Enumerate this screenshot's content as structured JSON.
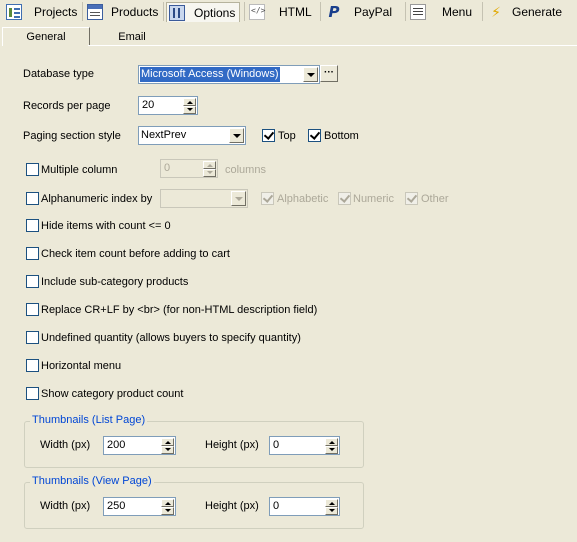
{
  "toolbar": {
    "items": [
      {
        "label": "Projects",
        "icon": "projects-icon"
      },
      {
        "label": "Products",
        "icon": "products-icon"
      },
      {
        "label": "Options",
        "icon": "options-icon",
        "active": true
      },
      {
        "label": "HTML",
        "icon": "html-icon"
      },
      {
        "label": "PayPal",
        "icon": "paypal-icon"
      },
      {
        "label": "Menu",
        "icon": "menu-icon"
      },
      {
        "label": "Generate",
        "icon": "generate-icon"
      }
    ]
  },
  "tabs": {
    "general": "General",
    "email": "Email"
  },
  "form": {
    "database_type": {
      "label": "Database type",
      "value": "Microsoft Access (Windows)",
      "dots": "···"
    },
    "records_per_page": {
      "label": "Records per page",
      "value": "20"
    },
    "paging_style": {
      "label": "Paging section style",
      "value": "NextPrev",
      "top_label": "Top",
      "top_checked": true,
      "bottom_label": "Bottom",
      "bottom_checked": true
    },
    "multiple_column": {
      "label": "Multiple column",
      "value": "0",
      "suffix": "columns",
      "checked": false
    },
    "alpha_index": {
      "label": "Alphanumeric index by",
      "value": "",
      "checked": false,
      "alphabetic": "Alphabetic",
      "numeric": "Numeric",
      "other": "Other"
    },
    "options": [
      {
        "label": "Hide items with count <= 0",
        "checked": false
      },
      {
        "label": "Check item count before adding to cart",
        "checked": false
      },
      {
        "label": "Include sub-category products",
        "checked": false
      },
      {
        "label": "Replace CR+LF by <br> (for non-HTML description field)",
        "checked": false
      },
      {
        "label": "Undefined quantity (allows buyers to specify quantity)",
        "checked": false
      },
      {
        "label": "Horizontal menu",
        "checked": false
      },
      {
        "label": "Show category product count",
        "checked": false
      }
    ],
    "thumb_list": {
      "title": "Thumbnails (List Page)",
      "width_label": "Width (px)",
      "width": "200",
      "height_label": "Height (px)",
      "height": "0"
    },
    "thumb_view": {
      "title": "Thumbnails (View Page)",
      "width_label": "Width (px)",
      "width": "250",
      "height_label": "Height (px)",
      "height": "0"
    }
  },
  "colors": {
    "accent": "#316ac5",
    "group_title": "#0046d5",
    "background": "#ece9d8"
  }
}
